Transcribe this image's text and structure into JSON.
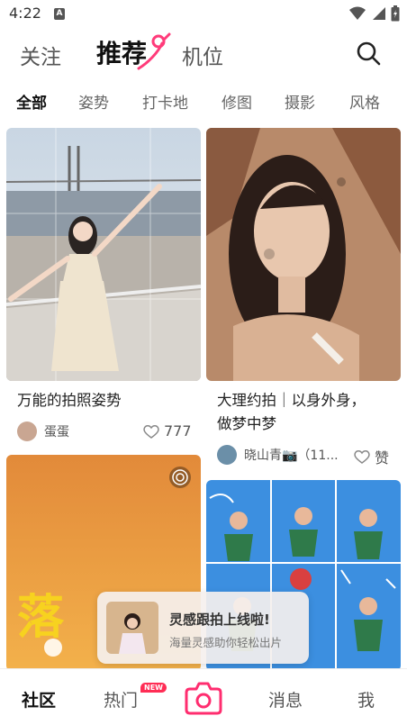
{
  "status_bar": {
    "time": "4:22",
    "notif_letter": "A"
  },
  "top_nav": {
    "tabs": [
      {
        "label": "关注"
      },
      {
        "label": "推荐"
      },
      {
        "label": "机位"
      }
    ],
    "active_tab": "推荐",
    "accent_color": "#ff3b7a"
  },
  "categories": {
    "items": [
      "全部",
      "姿势",
      "打卡地",
      "修图",
      "摄影",
      "风格"
    ],
    "active": "全部"
  },
  "feed": {
    "cards": [
      {
        "title": "万能的拍照姿势",
        "user": "蛋蛋",
        "likes": "777"
      },
      {
        "title_line1": "大理约拍｜以身外身，",
        "title_line2": "做梦中梦",
        "user": "晓山青📷（11...",
        "likes": "赞"
      }
    ],
    "card3_overlay_text": "落"
  },
  "toast": {
    "title": "灵感跟拍上线啦!",
    "subtitle": "海量灵感助你轻松出片"
  },
  "bottom_nav": {
    "items": [
      {
        "label": "社区"
      },
      {
        "label": "热门"
      },
      {
        "label": "消息"
      },
      {
        "label": "我"
      }
    ],
    "active": "社区",
    "new_badge": "NEW",
    "camera_color": "#ff2d6f"
  }
}
